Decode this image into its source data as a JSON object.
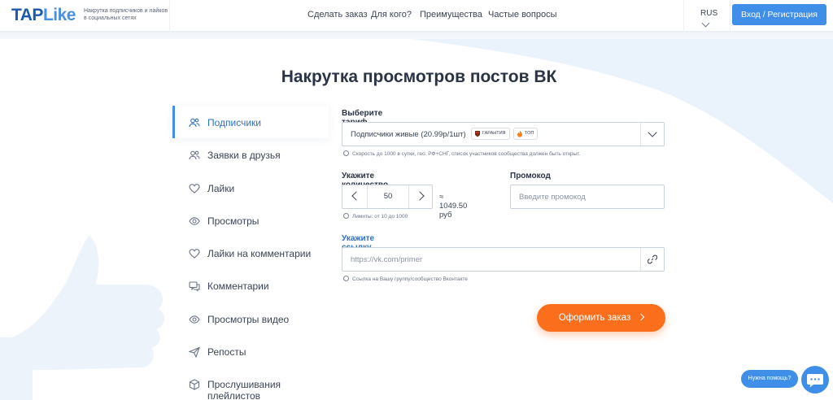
{
  "header": {
    "logo_tap": "TAP",
    "logo_like": "Like",
    "tagline": "Накрутка подписчиков и лайков в социальных сетях",
    "nav": [
      {
        "label": "Сделать заказ"
      },
      {
        "label": "Для кого?"
      },
      {
        "label": "Преимущества"
      },
      {
        "label": "Частые вопросы"
      }
    ],
    "lang": "RUS",
    "login_label": "Вход / Регистрация"
  },
  "page_title": "Накрутка просмотров постов ВК",
  "sidebar": {
    "items": [
      {
        "label": "Подписчики",
        "icon": "users-icon",
        "active": true
      },
      {
        "label": "Заявки в друзья",
        "icon": "friends-icon",
        "active": false
      },
      {
        "label": "Лайки",
        "icon": "heart-icon",
        "active": false
      },
      {
        "label": "Просмотры",
        "icon": "eye-icon",
        "active": false
      },
      {
        "label": "Лайки на комментарии",
        "icon": "heart-icon",
        "active": false
      },
      {
        "label": "Комментарии",
        "icon": "comments-icon",
        "active": false
      },
      {
        "label": "Просмотры видео",
        "icon": "eye-icon",
        "active": false
      },
      {
        "label": "Репосты",
        "icon": "send-icon",
        "active": false
      },
      {
        "label": "Прослушивания плейлистов",
        "icon": "box-icon",
        "active": false
      }
    ]
  },
  "form": {
    "tariff_label": "Выберите тариф",
    "tariff_value": "Подписчики живые (20.99р/1шт)",
    "badge_guarantee": "ГАРАНТИЯ",
    "badge_top": "ТОП",
    "tariff_hint": "Скорость до 1000 в сутки, гео: РФ+СНГ, список участников сообщества должен быть открыт.",
    "quantity_label": "Укажите количество",
    "quantity_value": "50",
    "price": "≈ 1049.50 руб",
    "quantity_hint": "Лимиты: от 10 до 1000",
    "promo_label": "Промокод",
    "promo_placeholder": "Введите промокод",
    "link_label": "Укажите ссылку",
    "link_placeholder": "https://vk.com/primer",
    "link_hint": "Ссылка на Вашу группу/сообщество Вконтакте",
    "submit_label": "Оформить заказ"
  },
  "help": {
    "label": "Нужна помощь?"
  },
  "colors": {
    "accent": "#3f8ee8",
    "cta": "#fb6f1c",
    "text": "#2a3444"
  }
}
